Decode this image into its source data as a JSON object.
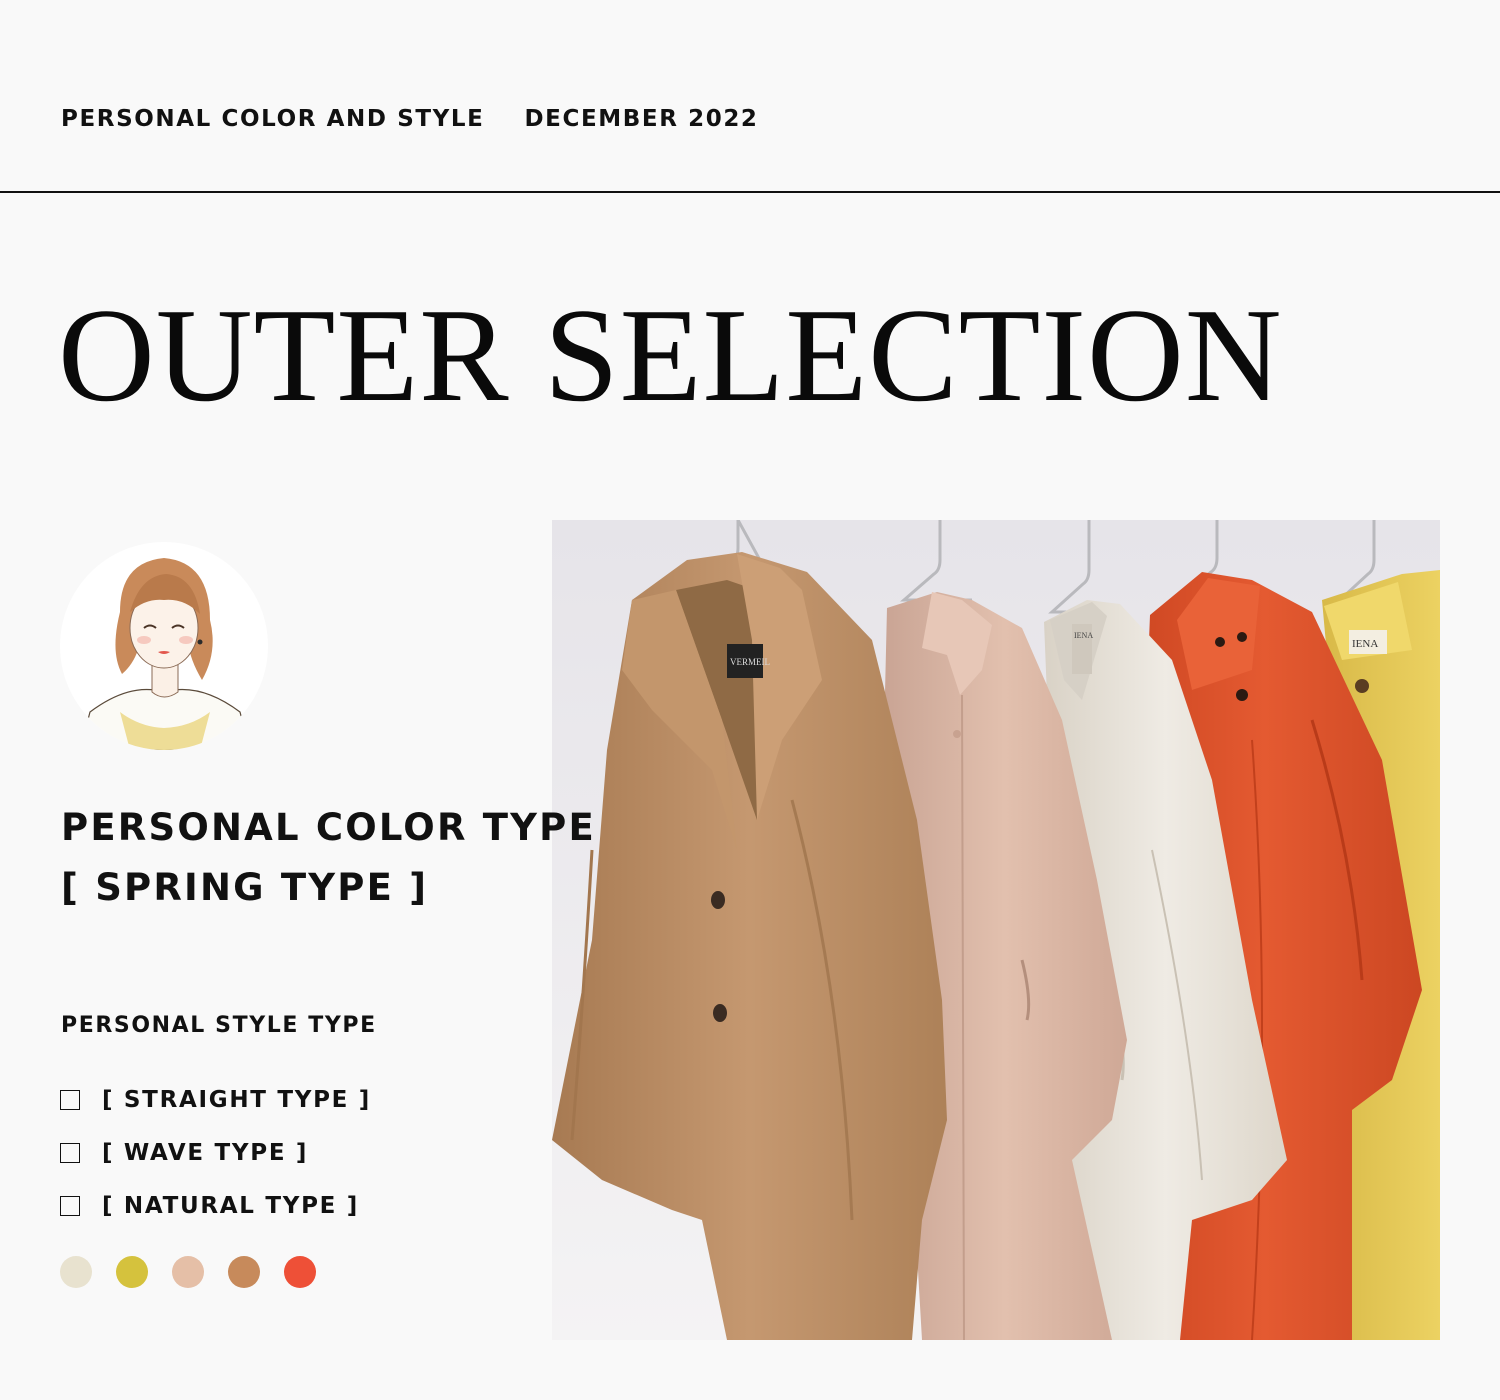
{
  "header": {
    "series": "PERSONAL COLOR AND STYLE",
    "issue": "DECEMBER 2022"
  },
  "title": "OUTER SELECTION",
  "personal_color": {
    "heading": "PERSONAL COLOR TYPE",
    "value": "[ SPRING TYPE ]"
  },
  "personal_style": {
    "heading": "PERSONAL STYLE TYPE",
    "options": [
      {
        "label": "[ STRAIGHT TYPE ]",
        "checked": false
      },
      {
        "label": "[ WAVE TYPE ]",
        "checked": false
      },
      {
        "label": "[ NATURAL TYPE ]",
        "checked": false
      }
    ]
  },
  "palette": [
    "#e8e2cf",
    "#d5c23d",
    "#e5bfa7",
    "#c78a5b",
    "#ee5037"
  ],
  "photo": {
    "coat_colors": [
      "#c09168",
      "#ddb9a8",
      "#ece7de",
      "#e05631",
      "#e7c956"
    ],
    "label_texts": [
      "VERMEIL",
      "IENA",
      "IENA"
    ]
  },
  "avatar": {
    "icon": "woman-illustration-icon"
  }
}
